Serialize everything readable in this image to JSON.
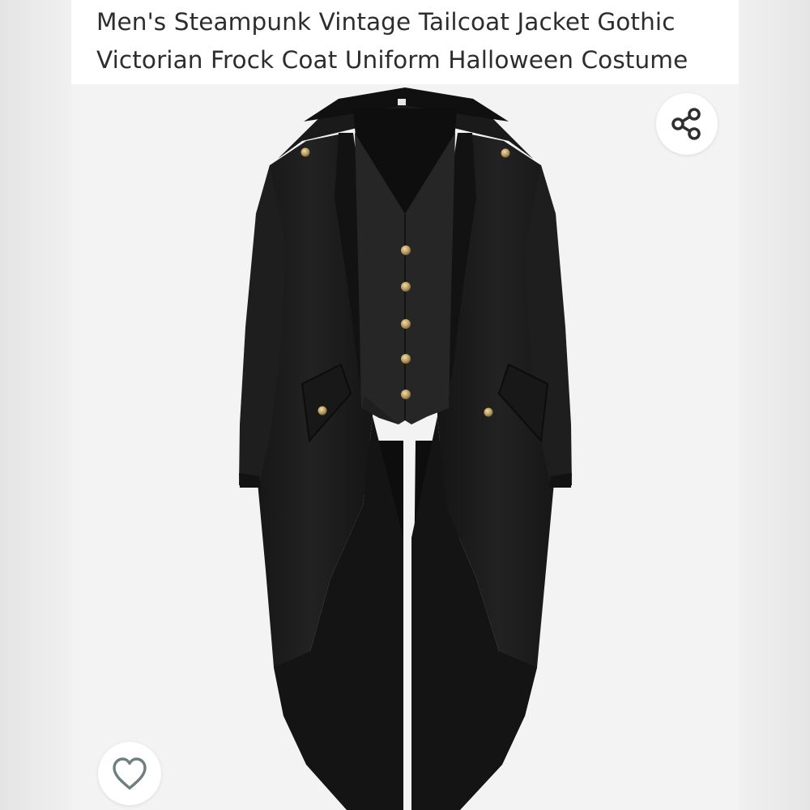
{
  "product": {
    "title_line1": "Men's Steampunk Vintage Tailcoat Jacket Gothic",
    "title_line2": "Victorian Frock Coat Uniform Halloween Costume"
  },
  "actions": {
    "share_icon": "share-icon",
    "wishlist_icon": "heart-outline-icon"
  },
  "colors": {
    "coat": "#1c1c1c",
    "vest": "#262626",
    "button_gold": "#b89a5e",
    "icon": "#2f2f2f",
    "wishlist_icon": "#6f7f80"
  }
}
